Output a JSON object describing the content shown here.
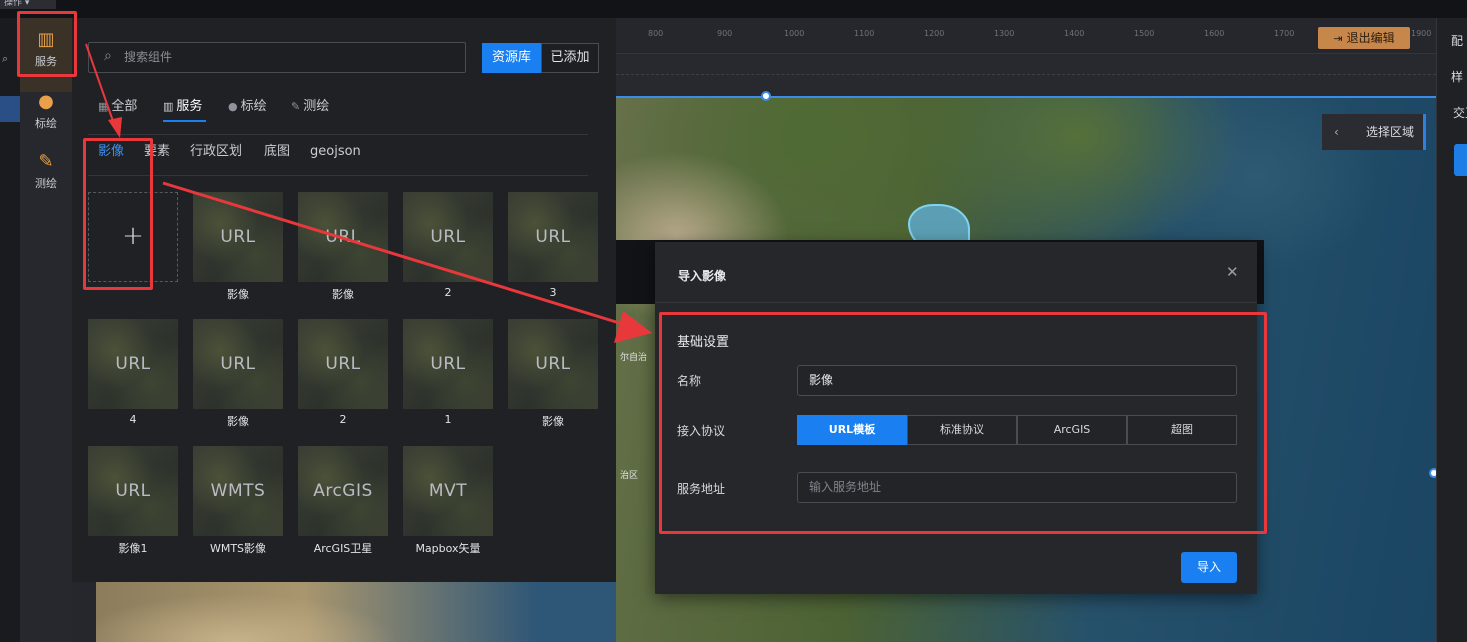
{
  "topbar": {
    "menu_label": "操作 ▾"
  },
  "ruler": {
    "ticks": [
      "800",
      "900",
      "1000",
      "1100",
      "1200",
      "1300",
      "1400",
      "1500",
      "1600",
      "1700",
      "1800",
      "1900"
    ]
  },
  "toolbar": {
    "exit_label": "退出编辑",
    "exit_icon": "exit-icon"
  },
  "map": {
    "select_area_label": "选择区域",
    "labels": [
      "尔自治",
      "治区"
    ]
  },
  "right_panel": {
    "row1": "配",
    "row2": "样",
    "row3": "交互"
  },
  "rail": {
    "items": [
      {
        "label": "服务",
        "icon": "map-icon"
      },
      {
        "label": "标绘",
        "icon": "location-pin-icon"
      },
      {
        "label": "测绘",
        "icon": "pencil-ruler-icon"
      }
    ]
  },
  "library": {
    "search_placeholder": "搜索组件",
    "source_tabs": [
      "资源库",
      "已添加"
    ],
    "category_tabs": [
      "全部",
      "服务",
      "标绘",
      "测绘"
    ],
    "sub_tabs": [
      "影像",
      "要素",
      "行政区划",
      "底图",
      "geojson"
    ],
    "add_glyph": "+",
    "tiles": [
      {
        "type": "URL",
        "caption": "影像"
      },
      {
        "type": "URL",
        "caption": "影像"
      },
      {
        "type": "URL",
        "caption": "2"
      },
      {
        "type": "URL",
        "caption": "3"
      },
      {
        "type": "URL",
        "caption": "4"
      },
      {
        "type": "URL",
        "caption": "影像"
      },
      {
        "type": "URL",
        "caption": "2"
      },
      {
        "type": "URL",
        "caption": "1"
      },
      {
        "type": "URL",
        "caption": "影像"
      },
      {
        "type": "URL",
        "caption": "影像1"
      },
      {
        "type": "WMTS",
        "caption": "WMTS影像"
      },
      {
        "type": "ArcGIS",
        "caption": "ArcGIS卫星"
      },
      {
        "type": "MVT",
        "caption": "Mapbox矢量"
      }
    ]
  },
  "dialog": {
    "title": "导入影像",
    "close_glyph": "✕",
    "section_title": "基础设置",
    "name_label": "名称",
    "name_value": "影像",
    "protocol_label": "接入协议",
    "protocols": [
      "URL模板",
      "标准协议",
      "ArcGIS",
      "超图"
    ],
    "address_label": "服务地址",
    "address_placeholder": "输入服务地址",
    "import_label": "导入"
  },
  "colors": {
    "accent": "#1a7ff0",
    "annotation": "#e8383c",
    "exit_button": "#c8874a"
  }
}
